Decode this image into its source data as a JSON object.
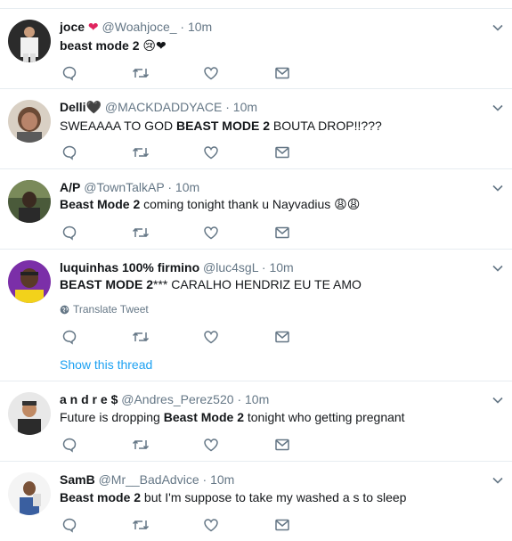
{
  "tweets": [
    {
      "name": "joce",
      "name_suffix": "❤",
      "handle": "@Woahjoce_",
      "sep": "·",
      "time": "10m",
      "text_bold": "beast mode 2",
      "text_rest": "",
      "text_emoji": "😢❤"
    },
    {
      "name": "Delli",
      "name_suffix": "🖤",
      "handle": "@MACKDADDYACE",
      "sep": "·",
      "time": "10m",
      "text_pre": "SWEAAAA TO GOD ",
      "text_bold": "BEAST MODE 2",
      "text_rest": " BOUTA DROP!!???"
    },
    {
      "name": "A/P",
      "handle": "@TownTalkAP",
      "sep": "·",
      "time": "10m",
      "text_bold": "Beast Mode 2",
      "text_rest": " coming tonight thank u Nayvadius ",
      "text_emoji": "😩😩"
    },
    {
      "name": "luquinhas 100% firmino",
      "handle": "@luc4sgL",
      "sep": "·",
      "time": "10m",
      "text_bold": "BEAST MODE 2",
      "text_rest": "*** CARALHO HENDRIZ EU TE AMO",
      "translate": "Translate Tweet",
      "thread": "Show this thread"
    },
    {
      "name": "a n d r e $",
      "handle": "@Andres_Perez520",
      "sep": "·",
      "time": "10m",
      "text_pre": "Future is dropping ",
      "text_bold": "Beast Mode 2",
      "text_rest": " tonight who getting pregnant"
    },
    {
      "name": "SamB",
      "handle": "@Mr__BadAdvice",
      "sep": "·",
      "time": "10m",
      "text_bold": "Beast mode 2",
      "text_rest": " but I'm suppose to take my washed a  s to sleep"
    }
  ],
  "colors": {
    "icon": "#657786",
    "link": "#1da1f2",
    "border": "#e6ecf0"
  }
}
